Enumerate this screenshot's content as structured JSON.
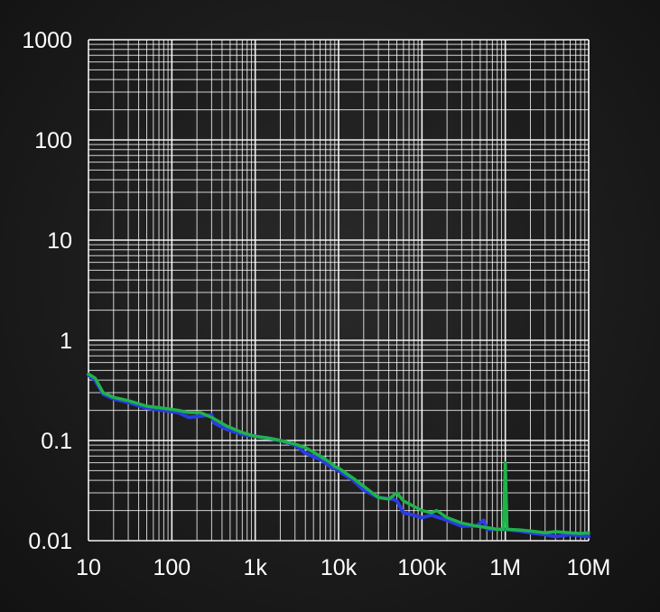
{
  "chart_data": {
    "type": "line",
    "title": "",
    "xlabel": "",
    "ylabel": "",
    "x_scale": "log",
    "y_scale": "log",
    "xlim": [
      10,
      10000000
    ],
    "ylim": [
      0.01,
      1000
    ],
    "grid": true,
    "background_color": "#ffffff00",
    "grid_color": "#ffffff",
    "x_ticks": [
      {
        "value": 10,
        "label": "10"
      },
      {
        "value": 100,
        "label": "100"
      },
      {
        "value": 1000,
        "label": "1k"
      },
      {
        "value": 10000,
        "label": "10k"
      },
      {
        "value": 100000,
        "label": "100k"
      },
      {
        "value": 1000000,
        "label": "1M"
      },
      {
        "value": 10000000,
        "label": "10M"
      }
    ],
    "y_ticks": [
      {
        "value": 0.01,
        "label": "0.01"
      },
      {
        "value": 0.1,
        "label": "0.1"
      },
      {
        "value": 1,
        "label": "1"
      },
      {
        "value": 10,
        "label": "10"
      },
      {
        "value": 100,
        "label": "100"
      },
      {
        "value": 1000,
        "label": "1000"
      }
    ],
    "series": [
      {
        "color": "#2a3de0",
        "points": [
          [
            10,
            0.45
          ],
          [
            12,
            0.4
          ],
          [
            15,
            0.29
          ],
          [
            20,
            0.26
          ],
          [
            30,
            0.24
          ],
          [
            50,
            0.21
          ],
          [
            80,
            0.2
          ],
          [
            120,
            0.19
          ],
          [
            160,
            0.17
          ],
          [
            220,
            0.175
          ],
          [
            300,
            0.18
          ],
          [
            320,
            0.15
          ],
          [
            450,
            0.13
          ],
          [
            700,
            0.115
          ],
          [
            1000,
            0.11
          ],
          [
            1500,
            0.105
          ],
          [
            2000,
            0.1
          ],
          [
            3000,
            0.09
          ],
          [
            4000,
            0.075
          ],
          [
            6000,
            0.065
          ],
          [
            8000,
            0.055
          ],
          [
            10000,
            0.05
          ],
          [
            15000,
            0.04
          ],
          [
            20000,
            0.032
          ],
          [
            30000,
            0.027
          ],
          [
            45000,
            0.026
          ],
          [
            50000,
            0.025
          ],
          [
            60000,
            0.019
          ],
          [
            80000,
            0.018
          ],
          [
            100000,
            0.017
          ],
          [
            130000,
            0.018
          ],
          [
            200000,
            0.016
          ],
          [
            300000,
            0.014
          ],
          [
            450000,
            0.014
          ],
          [
            550000,
            0.016
          ],
          [
            600000,
            0.013
          ],
          [
            800000,
            0.013
          ],
          [
            1000000,
            0.013
          ],
          [
            1500000,
            0.0125
          ],
          [
            2000000,
            0.012
          ],
          [
            3000000,
            0.0115
          ],
          [
            4000000,
            0.011
          ],
          [
            6000000,
            0.0115
          ],
          [
            10000000,
            0.011
          ]
        ]
      },
      {
        "color": "#1fb34a",
        "points": [
          [
            10,
            0.46
          ],
          [
            12,
            0.42
          ],
          [
            15,
            0.3
          ],
          [
            20,
            0.27
          ],
          [
            30,
            0.25
          ],
          [
            50,
            0.22
          ],
          [
            80,
            0.21
          ],
          [
            120,
            0.2
          ],
          [
            160,
            0.19
          ],
          [
            220,
            0.19
          ],
          [
            300,
            0.17
          ],
          [
            450,
            0.14
          ],
          [
            700,
            0.12
          ],
          [
            1000,
            0.11
          ],
          [
            1500,
            0.105
          ],
          [
            2000,
            0.1
          ],
          [
            3000,
            0.092
          ],
          [
            4000,
            0.085
          ],
          [
            6000,
            0.07
          ],
          [
            8000,
            0.06
          ],
          [
            9000,
            0.055
          ],
          [
            10000,
            0.053
          ],
          [
            15000,
            0.042
          ],
          [
            20000,
            0.035
          ],
          [
            30000,
            0.027
          ],
          [
            40000,
            0.026
          ],
          [
            50000,
            0.03
          ],
          [
            60000,
            0.025
          ],
          [
            80000,
            0.022
          ],
          [
            100000,
            0.02
          ],
          [
            130000,
            0.019
          ],
          [
            150000,
            0.02
          ],
          [
            200000,
            0.017
          ],
          [
            300000,
            0.015
          ],
          [
            450000,
            0.014
          ],
          [
            600000,
            0.0135
          ],
          [
            800000,
            0.013
          ],
          [
            950000,
            0.013
          ],
          [
            1000000,
            0.06
          ],
          [
            1050000,
            0.013
          ],
          [
            1500000,
            0.0128
          ],
          [
            2000000,
            0.0125
          ],
          [
            3000000,
            0.012
          ],
          [
            4000000,
            0.0123
          ],
          [
            6000000,
            0.012
          ],
          [
            8000000,
            0.0118
          ],
          [
            10000000,
            0.012
          ]
        ]
      }
    ]
  }
}
